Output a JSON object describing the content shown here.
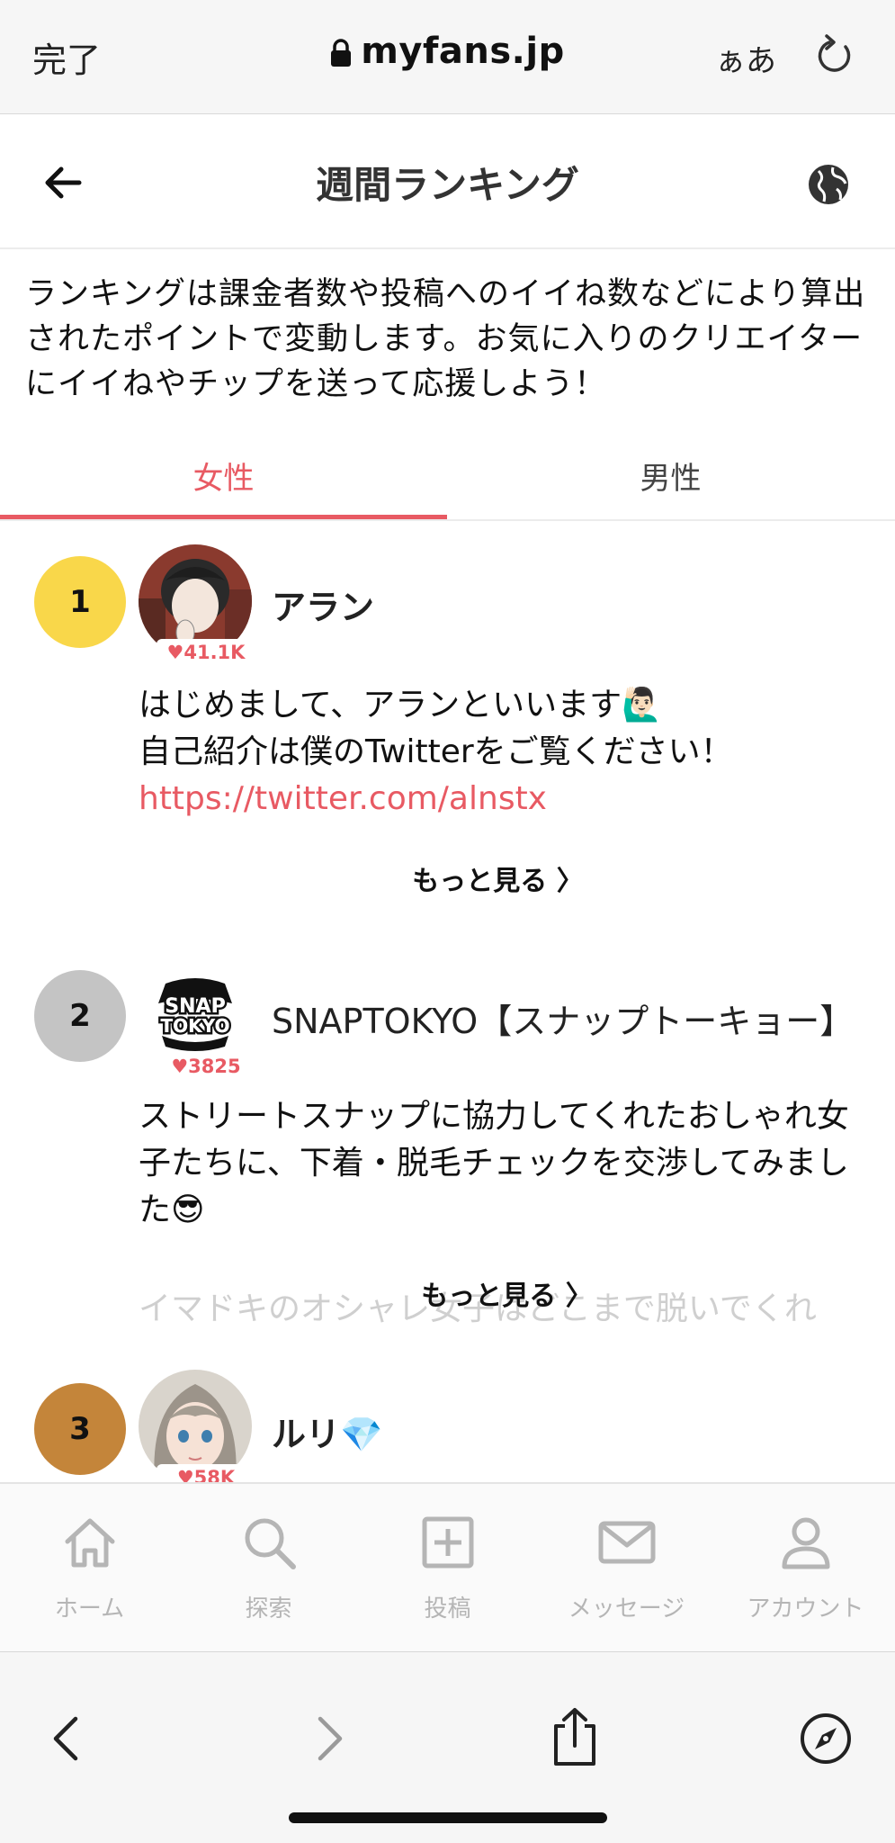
{
  "browser": {
    "done_label": "完了",
    "url": "myfans.jp",
    "text_size_label": "ぁあ"
  },
  "header": {
    "title": "週間ランキング"
  },
  "description": "ランキングは課金者数や投稿へのイイね数などにより算出されたポイントで変動します。お気に入りのクリエイターにイイねやチップを送って応援しよう！",
  "tabs": [
    {
      "label": "女性",
      "active": true
    },
    {
      "label": "男性",
      "active": false
    }
  ],
  "colors": {
    "accent": "#e85a63",
    "rank1": "#f9d74a",
    "rank2": "#c4c4c4",
    "rank3": "#c4853a"
  },
  "rankings": [
    {
      "rank": "1",
      "name": "アラン",
      "likes": "♥41.1K",
      "bio_line1": "はじめまして、アランといいます🙋🏻‍♂️",
      "bio_line2": "自己紹介は僕のTwitterをご覧ください！",
      "bio_link": "https://twitter.com/alnstx",
      "more_label": "もっと見る 〉"
    },
    {
      "rank": "2",
      "name": "SNAPTOKYO【スナップトーキョー】",
      "likes": "♥3825",
      "bio": "ストリートスナップに協力してくれたおしゃれ女子たちに、下着・脱毛チェックを交渉してみました😎",
      "bio_faded": "イマドキのオシャレ女子はどこまで脱いでくれ",
      "more_label": "もっと見る 〉"
    },
    {
      "rank": "3",
      "name": "ルリ💎",
      "likes": "♥58K"
    }
  ],
  "nav": [
    {
      "label": "ホーム",
      "icon": "home-icon"
    },
    {
      "label": "探索",
      "icon": "search-icon"
    },
    {
      "label": "投稿",
      "icon": "post-icon"
    },
    {
      "label": "メッセージ",
      "icon": "mail-icon"
    },
    {
      "label": "アカウント",
      "icon": "account-icon"
    }
  ]
}
